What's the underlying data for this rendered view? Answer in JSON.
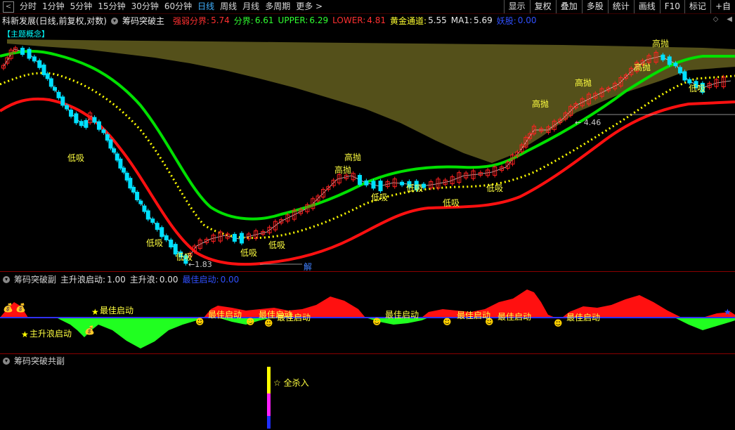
{
  "toolbar": {
    "periods": [
      "分时",
      "1分钟",
      "5分钟",
      "15分钟",
      "30分钟",
      "60分钟",
      "日线",
      "周线",
      "月线",
      "多周期",
      "更多"
    ],
    "active": "日线",
    "buttons": [
      "显示",
      "复权",
      "叠加",
      "多股",
      "统计",
      "画线",
      "F10",
      "标记",
      "+自"
    ]
  },
  "info": {
    "stock": "科新发展(日线,前复权,对数)",
    "indicator": "筹码突破主",
    "strong_weak_label": "强弱分界:",
    "strong_weak_val": "5.74",
    "split_label": "分界:",
    "split_val": "6.61",
    "upper_label": "UPPER:",
    "upper_val": "6.29",
    "lower_label": "LOWER:",
    "lower_val": "4.81",
    "gold_label": "黄金通道:",
    "gold_val": "5.55",
    "ma1_label": "MA1:",
    "ma1_val": "5.69",
    "tag_label": "妖股:",
    "tag_val": "0.00"
  },
  "main_chart": {
    "concept_label": "【主题概念】",
    "low_price_label": "←1.83",
    "high_price_label": "← 4.46",
    "jie_label": "解",
    "gaopao": "高抛",
    "dixi": "低吸",
    "colors": {
      "upper": "#00e000",
      "lower": "#ff1010",
      "gold": "#ffff00",
      "cloud": "#54501a",
      "up": "#ff2020",
      "down": "#00e0ff"
    }
  },
  "pane2": {
    "title": "筹码突破副",
    "k1_label": "主升浪启动:",
    "k1_val": "1.00",
    "k2_label": "主升浪:",
    "k2_val": "0.00",
    "k3_label": "最佳启动:",
    "k3_val": "0.00",
    "best_start": "最佳启动",
    "main_wave_start": "主升浪启动"
  },
  "pane3": {
    "title": "筹码突破共副",
    "kill_label": "☆ 全杀入"
  }
}
